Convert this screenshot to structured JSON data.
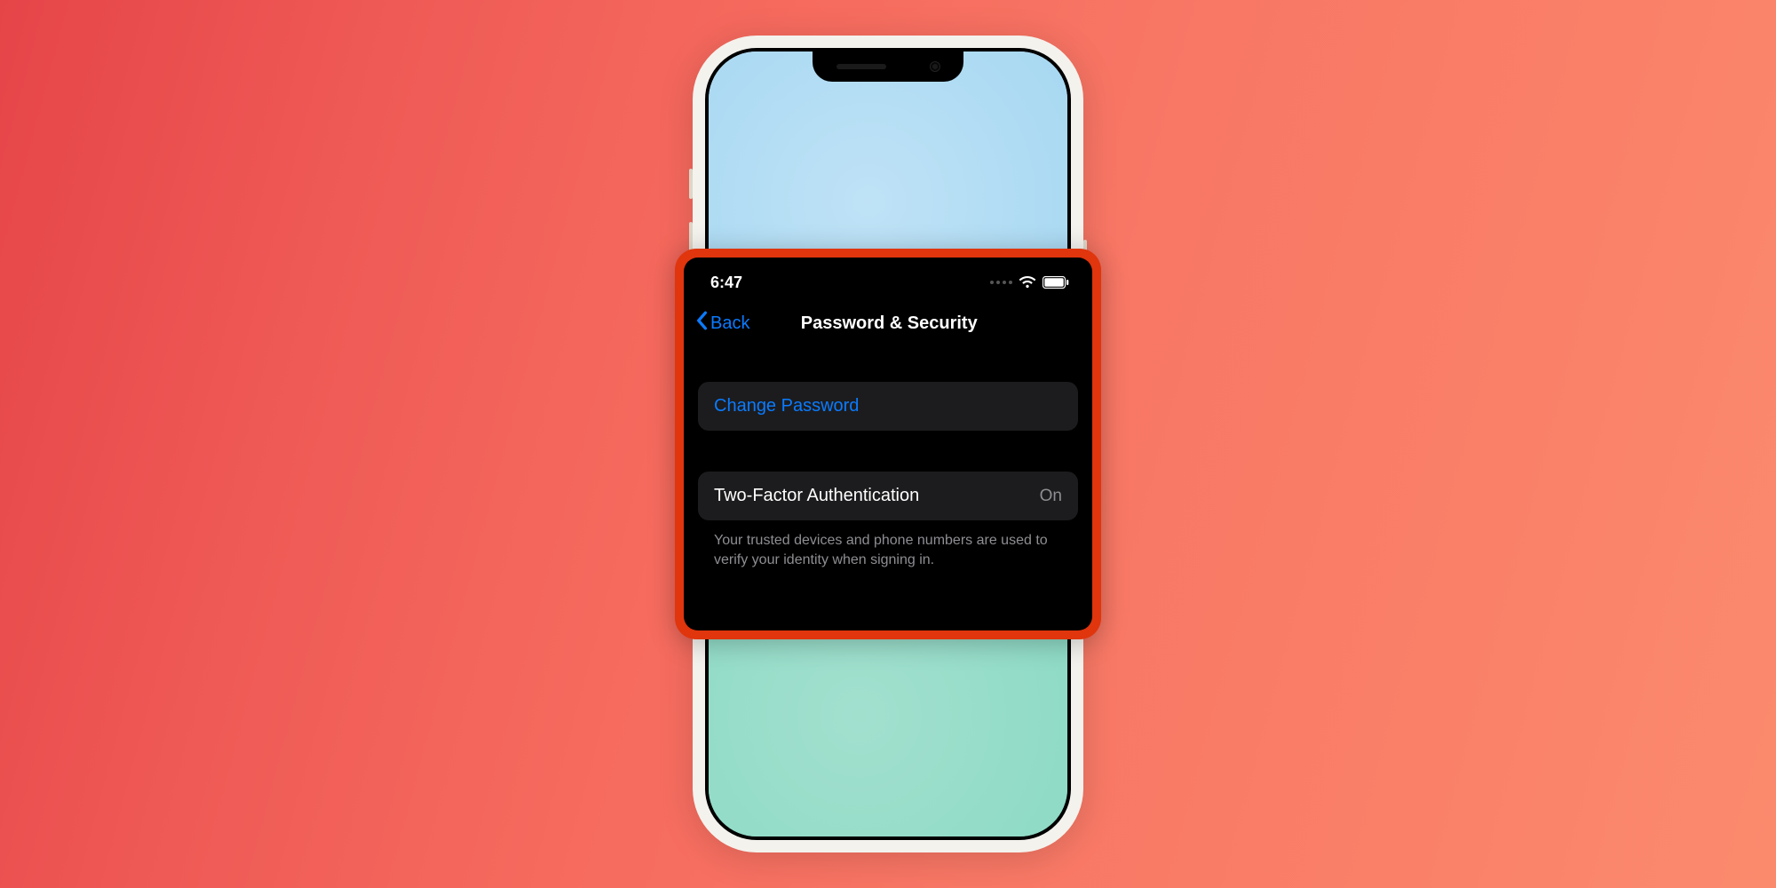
{
  "status": {
    "time": "6:47"
  },
  "nav": {
    "back_label": "Back",
    "title": "Password & Security"
  },
  "rows": {
    "change_password": "Change Password",
    "two_factor_label": "Two-Factor Authentication",
    "two_factor_value": "On"
  },
  "footer": "Your trusted devices and phone numbers are used to verify your identity when signing in."
}
